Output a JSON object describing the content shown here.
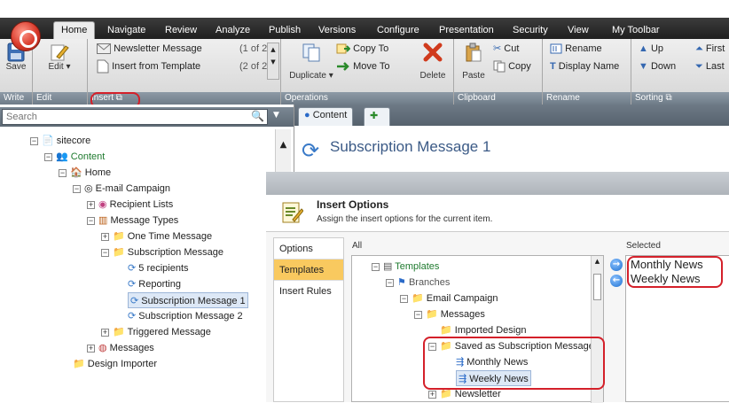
{
  "ribbon": {
    "tabs": [
      "Home",
      "Navigate",
      "Review",
      "Analyze",
      "Publish",
      "Versions",
      "Configure",
      "Presentation",
      "Security",
      "View",
      "My Toolbar"
    ],
    "write": {
      "label": "Write",
      "save": "Save"
    },
    "edit": {
      "label": "Edit",
      "edit": "Edit"
    },
    "insert": {
      "label": "Insert",
      "newsletter": "Newsletter Message",
      "newsletter_count": "(1 of 2)",
      "from_template": "Insert from Template",
      "from_template_count": "(2 of 2)"
    },
    "operations": {
      "label": "Operations",
      "duplicate": "Duplicate",
      "copy_to": "Copy To",
      "move_to": "Move To",
      "delete": "Delete"
    },
    "clipboard": {
      "label": "Clipboard",
      "paste": "Paste",
      "cut": "Cut",
      "copy": "Copy"
    },
    "rename": {
      "label": "Rename",
      "rename": "Rename",
      "display_name": "Display Name"
    },
    "sorting": {
      "label": "Sorting",
      "up": "Up",
      "down": "Down",
      "first": "First",
      "last": "Last"
    }
  },
  "search": {
    "placeholder": "Search"
  },
  "tree": [
    {
      "label": "sitecore"
    },
    {
      "label": "Content"
    },
    {
      "label": "Home"
    },
    {
      "label": "E-mail Campaign"
    },
    {
      "label": "Recipient Lists"
    },
    {
      "label": "Message Types"
    },
    {
      "label": "One Time Message"
    },
    {
      "label": "Subscription Message"
    },
    {
      "label": "5 recipients"
    },
    {
      "label": "Reporting"
    },
    {
      "label": "Subscription Message 1"
    },
    {
      "label": "Subscription Message 2"
    },
    {
      "label": "Triggered Message"
    },
    {
      "label": "Messages"
    },
    {
      "label": "Design Importer"
    }
  ],
  "content_tab": "Content",
  "item_title": "Subscription Message 1",
  "dialog": {
    "title": "Insert Options",
    "subtitle": "Assign the insert options for the current item.",
    "options": [
      "Options",
      "Templates",
      "Insert Rules"
    ],
    "all_label": "All",
    "selected_label": "Selected",
    "all_tree": [
      "Templates",
      "Branches",
      "Email Campaign",
      "Messages",
      "Imported Design",
      "Saved as Subscription Message",
      "Monthly News",
      "Weekly News",
      "Newsletter"
    ],
    "selected": [
      "Monthly News",
      "Weekly News"
    ]
  },
  "colors": {
    "highlight": "#d4202a",
    "active_option": "#f9c95f",
    "title_blue": "#3b5a86"
  }
}
